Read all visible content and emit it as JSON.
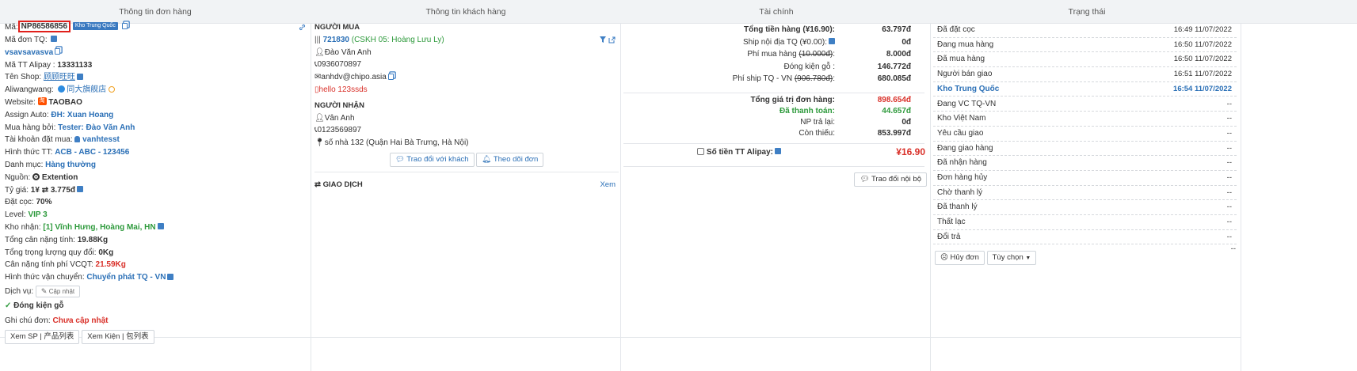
{
  "headers": {
    "order": "Thông tin đơn hàng",
    "customer": "Thông tin khách hàng",
    "finance": "Tài chính",
    "status": "Trạng thái"
  },
  "order": {
    "code_label": "Mã:",
    "code": "NP86586856",
    "warehouse_badge": "Kho Trung Quốc",
    "tq_code_label": "Mã đơn TQ:",
    "tq_code": "vsavsavasva",
    "alipay_label": "Mã TT Alipay :",
    "alipay": "13331133",
    "shop_label": "Tên Shop:",
    "shop": "顾顾旺旺",
    "aliwangwang_label": "Aliwangwang:",
    "aliwangwang": "同大旗舰店",
    "website_label": "Website:",
    "website": "TAOBAO",
    "assign_label": "Assign Auto:",
    "assign": "ĐH: Xuan Hoang",
    "buyer_label": "Mua hàng bởi:",
    "buyer": "Tester: Đào Văn Anh",
    "account_label": "Tài khoản đặt mua:",
    "account": "vanhtesst",
    "payment_label": "Hình thức TT:",
    "payment": "ACB - ABC - 123456",
    "category_label": "Danh mục:",
    "category": "Hàng thường",
    "source_label": "Nguồn:",
    "source": "Extention",
    "rate_label": "Tỷ giá:",
    "rate_left": "1¥",
    "rate_right": "3.775đ",
    "deposit_label": "Đặt cọc:",
    "deposit": "70%",
    "level_label": "Level:",
    "level": "VIP 3",
    "warehouse_label": "Kho nhận:",
    "warehouse": "[1] Vĩnh Hưng, Hoàng Mai, HN",
    "net_weight_label": "Tổng cân nặng tính:",
    "net_weight": "19.88Kg",
    "conv_weight_label": "Tổng trọng lượng quy đổi:",
    "conv_weight": "0Kg",
    "fee_weight_label": "Cân nặng tính phí VCQT:",
    "fee_weight": "21.59Kg",
    "shipping_label": "Hình thức vận chuyển:",
    "shipping": "Chuyển phát TQ - VN",
    "service_label": "Dịch vụ:",
    "update_btn": "Cập nhật",
    "packing": "Đóng kiện gỗ",
    "note_label": "Ghi chú đơn:",
    "note": "Chưa cập nhật",
    "btn_products": "Xem SP | 产品列表",
    "btn_packages": "Xem Kiện | 包列表"
  },
  "customer": {
    "buyer_title": "NGƯỜI MUA",
    "buyer_id": "721830",
    "buyer_cskh": "(CSKH 05: Hoàng Lưu Ly)",
    "buyer_name": "Đào Văn Anh",
    "buyer_phone": "0936070897",
    "buyer_email": "anhdv@chipo.asia",
    "buyer_note": "hello 123ssds",
    "receiver_title": "NGƯỜI NHẬN",
    "receiver_name": "Vân Anh",
    "receiver_phone": "0123569897",
    "receiver_address": "số nhà 132 (Quận Hai Bà Trưng, Hà Nội)",
    "btn_chat": "Trao đổi với khách",
    "btn_follow": "Theo dõi đơn",
    "transaction_title": "GIAO DỊCH",
    "view_link": "Xem"
  },
  "finance": {
    "rows": [
      {
        "label": "Tổng tiền hàng (¥16.90):",
        "value": "63.797đ"
      },
      {
        "label": "Ship nội địa TQ (¥0.00):",
        "value": "0đ"
      },
      {
        "label": "Phí mua hàng",
        "label_strike": "(10.000đ)",
        "value": "8.000đ"
      },
      {
        "label": "Đóng kiện gỗ :",
        "value": "146.772đ"
      },
      {
        "label": "Phí ship TQ - VN",
        "label_strike": "(906.780đ)",
        "value": "680.085đ"
      }
    ],
    "total_label": "Tổng giá trị đơn hàng:",
    "total": "898.654đ",
    "paid_label": "Đã thanh toán:",
    "paid": "44.657đ",
    "refund_label": "NP trả lại:",
    "refund": "0đ",
    "remaining_label": "Còn thiếu:",
    "remaining": "853.997đ",
    "alipay_label": "Số tiền TT Alipay:",
    "alipay_value": "¥16.90",
    "internal_btn": "Trao đổi nội bộ"
  },
  "status": {
    "rows": [
      {
        "name": "Đã đặt cọc",
        "time": "16:49 11/07/2022"
      },
      {
        "name": "Đang mua hàng",
        "time": "16:50 11/07/2022"
      },
      {
        "name": "Đã mua hàng",
        "time": "16:50 11/07/2022"
      },
      {
        "name": "Người bán giao",
        "time": "16:51 11/07/2022"
      },
      {
        "name": "Kho Trung Quốc",
        "time": "16:54 11/07/2022"
      },
      {
        "name": "Đang VC TQ-VN",
        "time": "--"
      },
      {
        "name": "Kho Việt Nam",
        "time": "--"
      },
      {
        "name": "Yêu cầu giao",
        "time": "--"
      },
      {
        "name": "Đang giao hàng",
        "time": "--"
      },
      {
        "name": "Đã nhận hàng",
        "time": "--"
      },
      {
        "name": "Đơn hàng hủy",
        "time": "--"
      },
      {
        "name": "Chờ thanh lý",
        "time": "--"
      },
      {
        "name": "Đã thanh lý",
        "time": "--"
      },
      {
        "name": "Thất lạc",
        "time": "--"
      },
      {
        "name": "Đổi trả",
        "time": "--"
      }
    ],
    "cancel_btn": "Hủy đơn",
    "options_btn": "Tùy chọn",
    "trailing": "--"
  },
  "colors": {
    "accent_blue": "#2a6fb6",
    "green": "#2e9a3c",
    "red": "#d9312a",
    "highlight": "#e0201b"
  }
}
